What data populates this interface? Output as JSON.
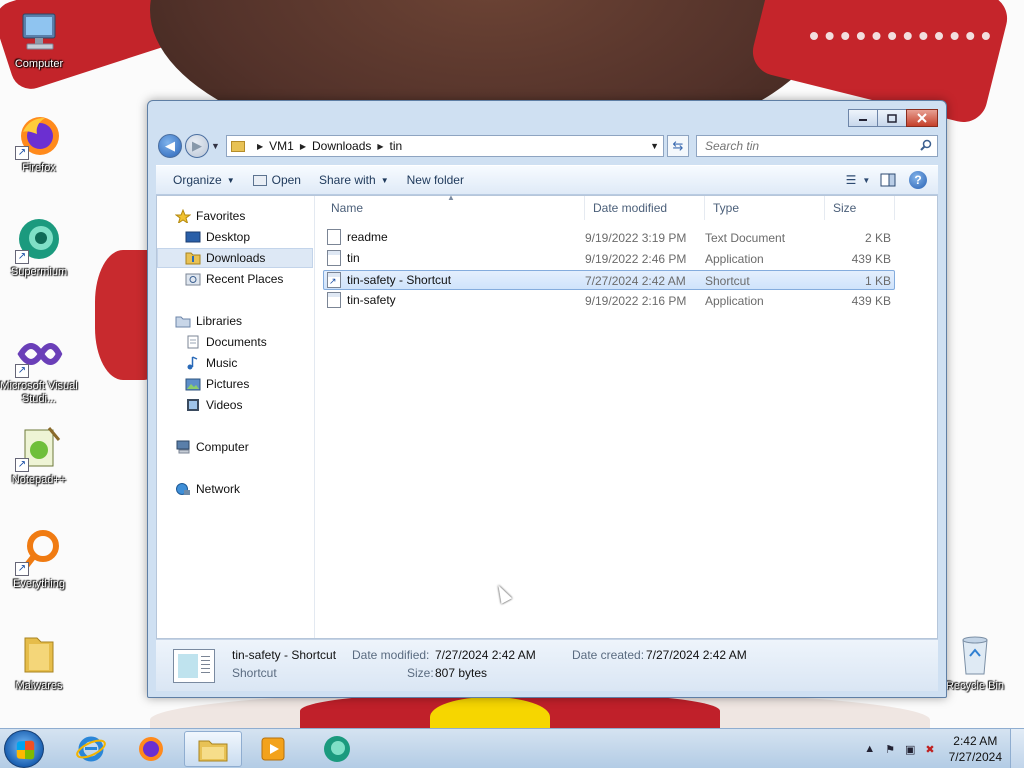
{
  "desktop": {
    "icons": [
      {
        "label": "Computer",
        "icon": "computer-icon"
      },
      {
        "label": "Firefox",
        "icon": "firefox-icon"
      },
      {
        "label": "Supermium",
        "icon": "supermium-icon"
      },
      {
        "label": "Microsoft Visual Studi...",
        "icon": "visual-studio-icon"
      },
      {
        "label": "Notepad++",
        "icon": "notepadpp-icon"
      },
      {
        "label": "Everything",
        "icon": "everything-icon"
      },
      {
        "label": "Malwares",
        "icon": "folder-icon"
      },
      {
        "label": "Recycle Bin",
        "icon": "recycle-bin-icon"
      }
    ]
  },
  "window": {
    "breadcrumb": [
      "VM1",
      "Downloads",
      "tin"
    ],
    "search_placeholder": "Search tin",
    "toolbar": {
      "organize": "Organize",
      "open": "Open",
      "share_with": "Share with",
      "new_folder": "New folder"
    },
    "nav": {
      "favorites": "Favorites",
      "desktop": "Desktop",
      "downloads": "Downloads",
      "recent_places": "Recent Places",
      "libraries": "Libraries",
      "documents": "Documents",
      "music": "Music",
      "pictures": "Pictures",
      "videos": "Videos",
      "computer": "Computer",
      "network": "Network"
    },
    "columns": {
      "name": "Name",
      "date_modified": "Date modified",
      "type": "Type",
      "size": "Size"
    },
    "files": [
      {
        "name": "readme",
        "date": "9/19/2022 3:19 PM",
        "type": "Text Document",
        "size": "2 KB",
        "icon": "text-file-icon"
      },
      {
        "name": "tin",
        "date": "9/19/2022 2:46 PM",
        "type": "Application",
        "size": "439 KB",
        "icon": "application-icon"
      },
      {
        "name": "tin-safety - Shortcut",
        "date": "7/27/2024 2:42 AM",
        "type": "Shortcut",
        "size": "1 KB",
        "icon": "shortcut-icon"
      },
      {
        "name": "tin-safety",
        "date": "9/19/2022 2:16 PM",
        "type": "Application",
        "size": "439 KB",
        "icon": "application-icon"
      }
    ],
    "details": {
      "name": "tin-safety - Shortcut",
      "kind": "Shortcut",
      "date_modified_label": "Date modified:",
      "date_modified": "7/27/2024 2:42 AM",
      "date_created_label": "Date created:",
      "date_created": "7/27/2024 2:42 AM",
      "size_label": "Size:",
      "size": "807 bytes"
    }
  },
  "taskbar": {
    "time": "2:42 AM",
    "date": "7/27/2024"
  }
}
